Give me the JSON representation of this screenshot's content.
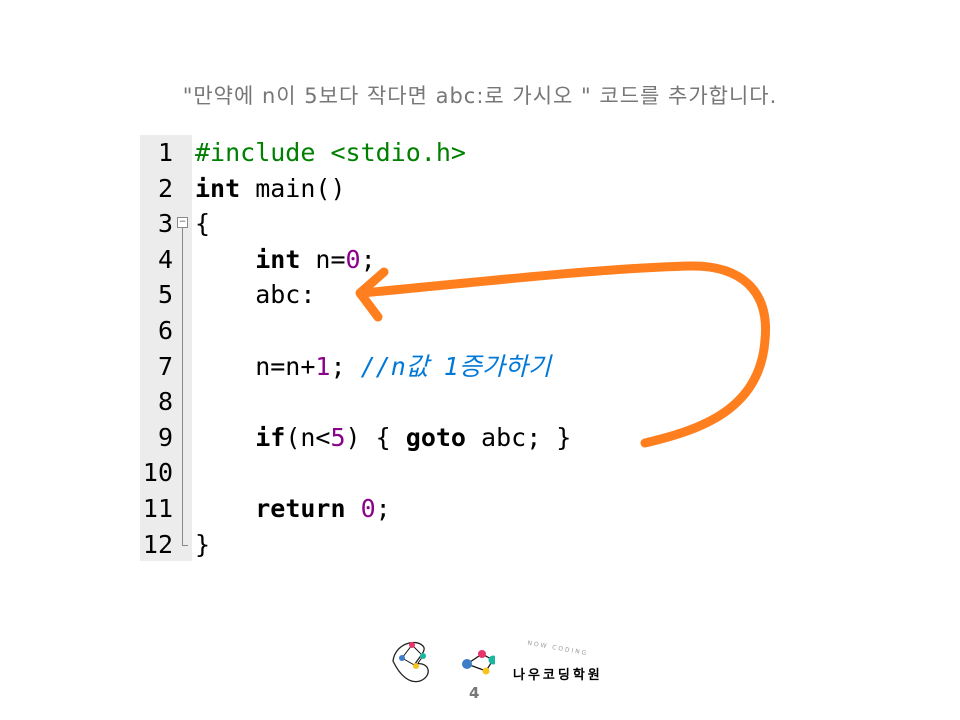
{
  "title": "\"만약에 n이 5보다 작다면 abc:로 가시오   \" 코드를 추가합니다.",
  "code": {
    "lines": [
      {
        "n": "1",
        "parts": [
          {
            "t": "#include <stdio.h>",
            "c": "pp"
          }
        ]
      },
      {
        "n": "2",
        "parts": [
          {
            "t": "int",
            "c": "kw"
          },
          {
            "t": " main()",
            "c": ""
          }
        ]
      },
      {
        "n": "3",
        "parts": [
          {
            "t": "{",
            "c": ""
          }
        ]
      },
      {
        "n": "4",
        "parts": [
          {
            "t": "    ",
            "c": ""
          },
          {
            "t": "int",
            "c": "kw"
          },
          {
            "t": " n=",
            "c": ""
          },
          {
            "t": "0",
            "c": "num"
          },
          {
            "t": ";",
            "c": ""
          }
        ]
      },
      {
        "n": "5",
        "parts": [
          {
            "t": "    abc:",
            "c": ""
          }
        ]
      },
      {
        "n": "6",
        "parts": []
      },
      {
        "n": "7",
        "parts": [
          {
            "t": "    n=n+",
            "c": ""
          },
          {
            "t": "1",
            "c": "num"
          },
          {
            "t": "; ",
            "c": ""
          },
          {
            "t": "//n값 1증가하기",
            "c": "cm"
          }
        ]
      },
      {
        "n": "8",
        "parts": []
      },
      {
        "n": "9",
        "parts": [
          {
            "t": "    ",
            "c": ""
          },
          {
            "t": "if",
            "c": "kw"
          },
          {
            "t": "(n<",
            "c": ""
          },
          {
            "t": "5",
            "c": "num"
          },
          {
            "t": ") { ",
            "c": ""
          },
          {
            "t": "goto",
            "c": "kw"
          },
          {
            "t": " abc; }",
            "c": ""
          }
        ]
      },
      {
        "n": "10",
        "parts": []
      },
      {
        "n": "11",
        "parts": [
          {
            "t": "    ",
            "c": ""
          },
          {
            "t": "return",
            "c": "kw"
          },
          {
            "t": " ",
            "c": ""
          },
          {
            "t": "0",
            "c": "num"
          },
          {
            "t": ";",
            "c": ""
          }
        ]
      },
      {
        "n": "12",
        "parts": [
          {
            "t": "}",
            "c": ""
          }
        ]
      }
    ]
  },
  "colors": {
    "arrow": "#ff7f1e",
    "keyword": "#000000",
    "preprocessor": "#008000",
    "number": "#8b008b",
    "comment": "#0078d7"
  },
  "footer": {
    "page": "4",
    "brand": "나우코딩학원",
    "brand_sub": "NOW CODING"
  }
}
